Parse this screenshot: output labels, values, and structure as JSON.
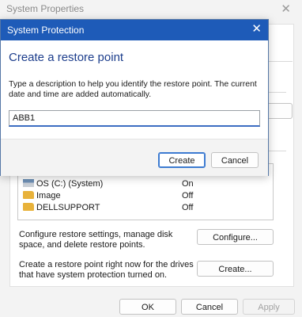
{
  "background_window": {
    "title": "System Properties",
    "drives": [
      {
        "name": "OS (C:) (System)",
        "status": "On",
        "icon": "system-drive-icon"
      },
      {
        "name": "Image",
        "status": "Off",
        "icon": "folder-icon"
      },
      {
        "name": "DELLSUPPORT",
        "status": "Off",
        "icon": "folder-icon"
      }
    ],
    "configure_text": "Configure restore settings, manage disk space, and delete restore points.",
    "configure_button": "Configure...",
    "create_text": "Create a restore point right now for the drives that have system protection turned on.",
    "create_button": "Create...",
    "ok_button": "OK",
    "cancel_button": "Cancel",
    "apply_button": "Apply"
  },
  "dialog": {
    "title": "System Protection",
    "heading": "Create a restore point",
    "description": "Type a description to help you identify the restore point. The current date and time are added automatically.",
    "input_value": "ABB1",
    "create_button": "Create",
    "cancel_button": "Cancel"
  },
  "colors": {
    "titlebar": "#1e5bb8",
    "heading": "#1c3d8c",
    "primary_border": "#3d7bd1"
  }
}
